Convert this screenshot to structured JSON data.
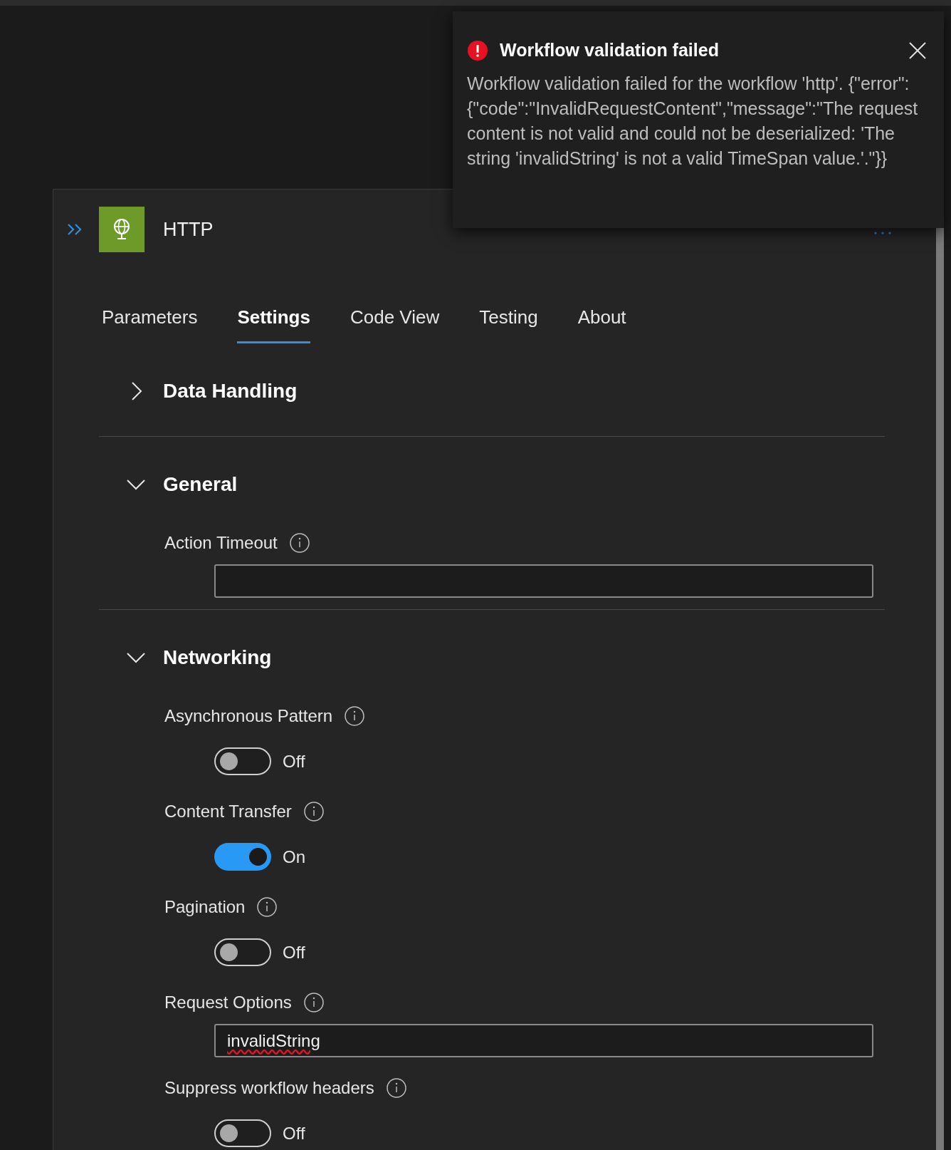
{
  "toast": {
    "title": "Workflow validation failed",
    "message": "Workflow validation failed for the workflow 'http'. {\"error\":{\"code\":\"InvalidRequestContent\",\"message\":\"The request content is not valid and could not be deserialized: 'The string 'invalidString' is not a valid TimeSpan value.'.\"}}"
  },
  "panel": {
    "title": "HTTP"
  },
  "tabs": [
    {
      "label": "Parameters",
      "selected": false
    },
    {
      "label": "Settings",
      "selected": true
    },
    {
      "label": "Code View",
      "selected": false
    },
    {
      "label": "Testing",
      "selected": false
    },
    {
      "label": "About",
      "selected": false
    }
  ],
  "sections": [
    {
      "title": "Data Handling",
      "expanded": false
    },
    {
      "title": "General",
      "expanded": true,
      "settings": [
        {
          "kind": "field",
          "label": "Action Timeout"
        }
      ]
    },
    {
      "title": "Networking",
      "expanded": true,
      "settings": [
        {
          "kind": "toggle",
          "label": "Asynchronous Pattern",
          "on": false,
          "state": "Off"
        },
        {
          "kind": "toggle",
          "label": "Content Transfer",
          "on": true,
          "state": "On"
        },
        {
          "kind": "toggle",
          "label": "Pagination",
          "on": false,
          "state": "Off"
        },
        {
          "kind": "field",
          "label": "Request Options",
          "value": "invalidString",
          "misspelled": true
        },
        {
          "kind": "toggle",
          "label": "Suppress workflow headers",
          "on": false,
          "state": "Off"
        }
      ]
    }
  ]
}
